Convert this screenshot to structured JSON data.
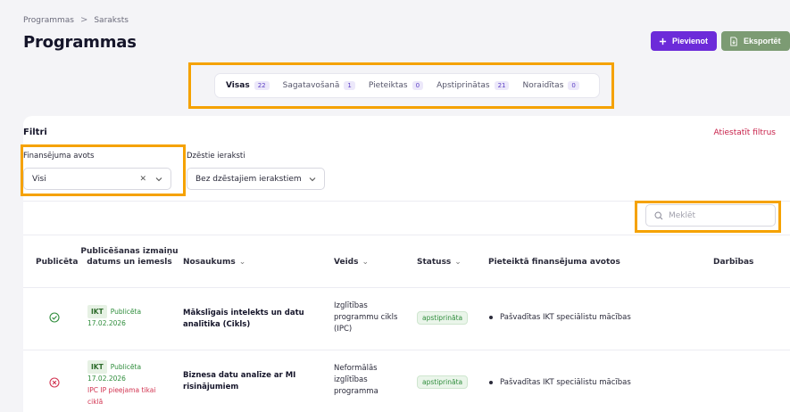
{
  "breadcrumb": {
    "items": [
      "Programmas",
      "Saraksts"
    ],
    "separator": ">"
  },
  "page": {
    "title": "Programmas"
  },
  "actions": {
    "add_label": "Pievienot",
    "export_label": "Eksportēt"
  },
  "tabs": [
    {
      "label": "Visas",
      "count": "22",
      "active": true
    },
    {
      "label": "Sagatavošanā",
      "count": "1"
    },
    {
      "label": "Pieteiktas",
      "count": "0"
    },
    {
      "label": "Apstiprinātas",
      "count": "21"
    },
    {
      "label": "Noraidītas",
      "count": "0"
    }
  ],
  "filters": {
    "title": "Filtri",
    "reset_label": "Atiestatīt filtrus",
    "funding": {
      "label": "Finansējuma avots",
      "value": "Visi"
    },
    "deleted": {
      "label": "Dzēstie ieraksti",
      "value": "Bez dzēstajiem ierakstiem"
    }
  },
  "search": {
    "placeholder": "Meklēt"
  },
  "table": {
    "headers": {
      "published": "Publicēta",
      "change_date": "Publicēšanas izmaiņu datums un iemesls",
      "name": "Nosaukums",
      "type": "Veids",
      "status": "Statuss",
      "funding": "Pieteiktā finansējuma avotos",
      "actions": "Darbības"
    },
    "rows": [
      {
        "published_icon": "check-circle-icon",
        "tag": "IKT",
        "pub_label": "Publicēta",
        "date": "17.02.2026",
        "note": "",
        "name_l1": "Mākslīgais intelekts un datu",
        "name_l2": "analītika (Cikls)",
        "type_l1": "Izglītības",
        "type_l2": "programmu cikls",
        "type_l3": "(IPC)",
        "status": "apstiprināta",
        "funding": "Pašvadītas IKT speciālistu mācības"
      },
      {
        "published_icon": "x-circle-icon",
        "tag": "IKT",
        "pub_label": "Publicēta",
        "date": "17.02.2026",
        "note_l1": "IPC IP pieejama tikai",
        "note_l2": "ciklā",
        "name_l1": "Biznesa datu analīze ar MI",
        "name_l2": "risinājumiem",
        "type_l1": "Neformālās",
        "type_l2": "izglītības",
        "type_l3": "programma",
        "status": "apstiprināta",
        "funding": "Pašvadītas IKT speciālistu mācības"
      }
    ]
  },
  "colors": {
    "accent": "#6c2bd9",
    "export": "#7c9b73",
    "highlight": "#f5a200",
    "success": "#2f8d3c",
    "danger": "#d23552"
  }
}
